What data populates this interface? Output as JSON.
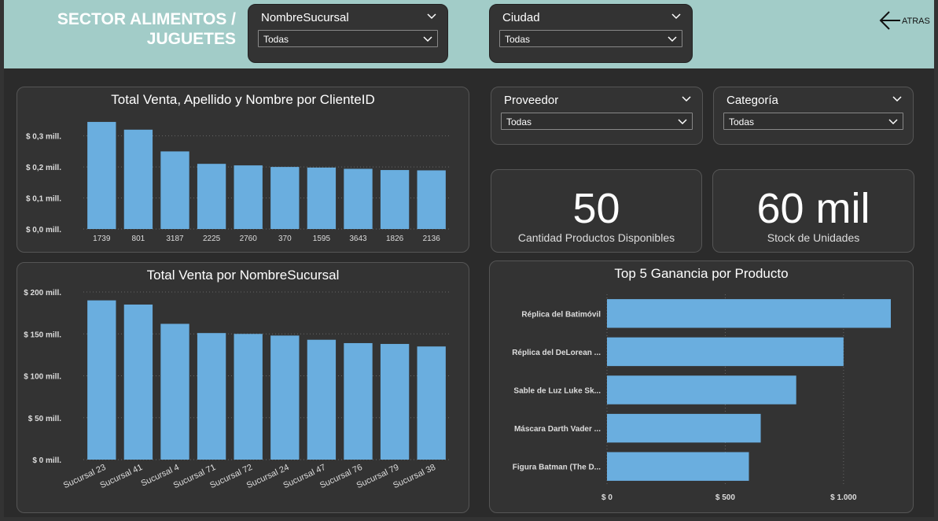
{
  "header": {
    "title_line1": "SECTOR ALIMENTOS /",
    "title_line2": "JUGUETES",
    "back_label": "ATRAS"
  },
  "slicers": {
    "sucursal": {
      "title": "NombreSucursal",
      "value": "Todas"
    },
    "ciudad": {
      "title": "Ciudad",
      "value": "Todas"
    },
    "proveedor": {
      "title": "Proveedor",
      "value": "Todas"
    },
    "categoria": {
      "title": "Categoría",
      "value": "Todas"
    }
  },
  "kpis": {
    "productos": {
      "value": "50",
      "label": "Cantidad Productos Disponibles"
    },
    "stock": {
      "value": "60 mil",
      "label": "Stock de Unidades"
    }
  },
  "colors": {
    "bar": "#6aaedf",
    "header": "#a2ccc8"
  },
  "chart_data": [
    {
      "type": "bar",
      "title": "Total Venta, Apellido y Nombre por ClienteID",
      "categories": [
        "1739",
        "801",
        "3187",
        "2225",
        "2760",
        "370",
        "1595",
        "3643",
        "1826",
        "2136"
      ],
      "values": [
        0.345,
        0.32,
        0.25,
        0.21,
        0.205,
        0.2,
        0.198,
        0.194,
        0.19,
        0.189
      ],
      "ylim": [
        0,
        0.36
      ],
      "yticks": [
        0,
        0.1,
        0.2,
        0.3
      ],
      "ytick_labels": [
        "$ 0,0 mill.",
        "$ 0,1 mill.",
        "$ 0,2 mill.",
        "$ 0,3 mill."
      ],
      "grid": true
    },
    {
      "type": "bar",
      "title": "Total Venta por NombreSucursal",
      "categories": [
        "Sucursal 23",
        "Sucursal 41",
        "Sucursal 4",
        "Sucursal 71",
        "Sucursal 72",
        "Sucursal 24",
        "Sucursal 47",
        "Sucursal 76",
        "Sucursal 79",
        "Sucursal 38"
      ],
      "values": [
        190,
        185,
        162,
        151,
        150,
        148,
        143,
        139,
        138,
        135
      ],
      "ylim": [
        0,
        200
      ],
      "yticks": [
        0,
        50,
        100,
        150,
        200
      ],
      "ytick_labels": [
        "$ 0 mill.",
        "$ 50 mill.",
        "$ 100 mill.",
        "$ 150 mill.",
        "$ 200 mill."
      ],
      "grid": true
    },
    {
      "type": "bar",
      "orientation": "horizontal",
      "title": "Top 5 Ganancia por Producto",
      "categories": [
        "Réplica del Batimóvil",
        "Réplica del DeLorean ...",
        "Sable de Luz Luke Sk...",
        "Máscara Darth Vader ...",
        "Figura Batman (The D..."
      ],
      "values": [
        1200,
        1000,
        800,
        650,
        600
      ],
      "xlim": [
        0,
        1200
      ],
      "xticks": [
        0,
        500,
        1000
      ],
      "xtick_labels": [
        "$ 0",
        "$ 500",
        "$ 1.000"
      ],
      "grid": true
    }
  ]
}
